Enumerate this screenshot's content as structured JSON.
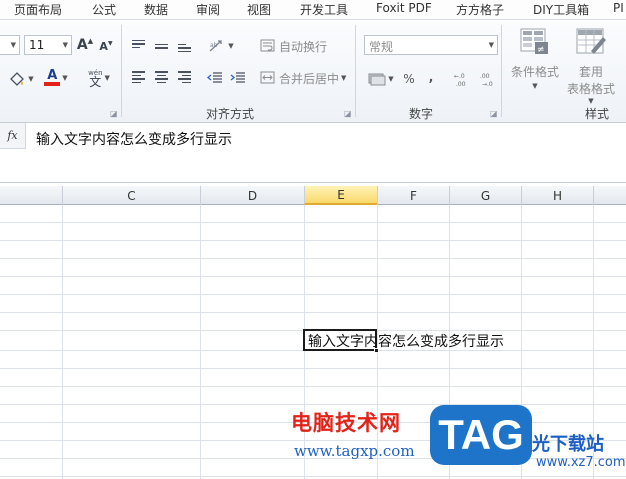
{
  "menu": [
    "页面布局",
    "公式",
    "数据",
    "审阅",
    "视图",
    "开发工具",
    "Foxit PDF",
    "方方格子",
    "DIY工具箱",
    "PI"
  ],
  "font": {
    "size": "11",
    "grow_glyph": "A",
    "shrink_glyph": "A",
    "font_color_glyph": "A",
    "phonetic_glyph": "文"
  },
  "alignment": {
    "wrap_text": "自动换行",
    "merge_center": "合并后居中",
    "group_label": "对齐方式"
  },
  "number": {
    "format": "常规",
    "percent": "%",
    "comma": ",",
    "group_label": "数字"
  },
  "styles": {
    "conditional": "条件格式",
    "table_format_1": "套用",
    "table_format_2": "表格格式",
    "group_label": "样式"
  },
  "formula_bar": {
    "fx_label": "fx",
    "content": "输入文字内容怎么变成多行显示"
  },
  "columns": [
    "C",
    "D",
    "E",
    "F",
    "G",
    "H"
  ],
  "active_column": "E",
  "cell": {
    "address_column": "E",
    "value": "输入文字内容怎么变成多行显示"
  },
  "watermarks": {
    "cn_title": "电脑技术网",
    "url": "www.tagxp.com",
    "tag": "TAG",
    "site_name": "光下载站",
    "site_url": "www.xz7.com"
  },
  "colors": {
    "accent": "#1e74c9",
    "red": "#e2231a",
    "active_col": "#f9d96c"
  }
}
